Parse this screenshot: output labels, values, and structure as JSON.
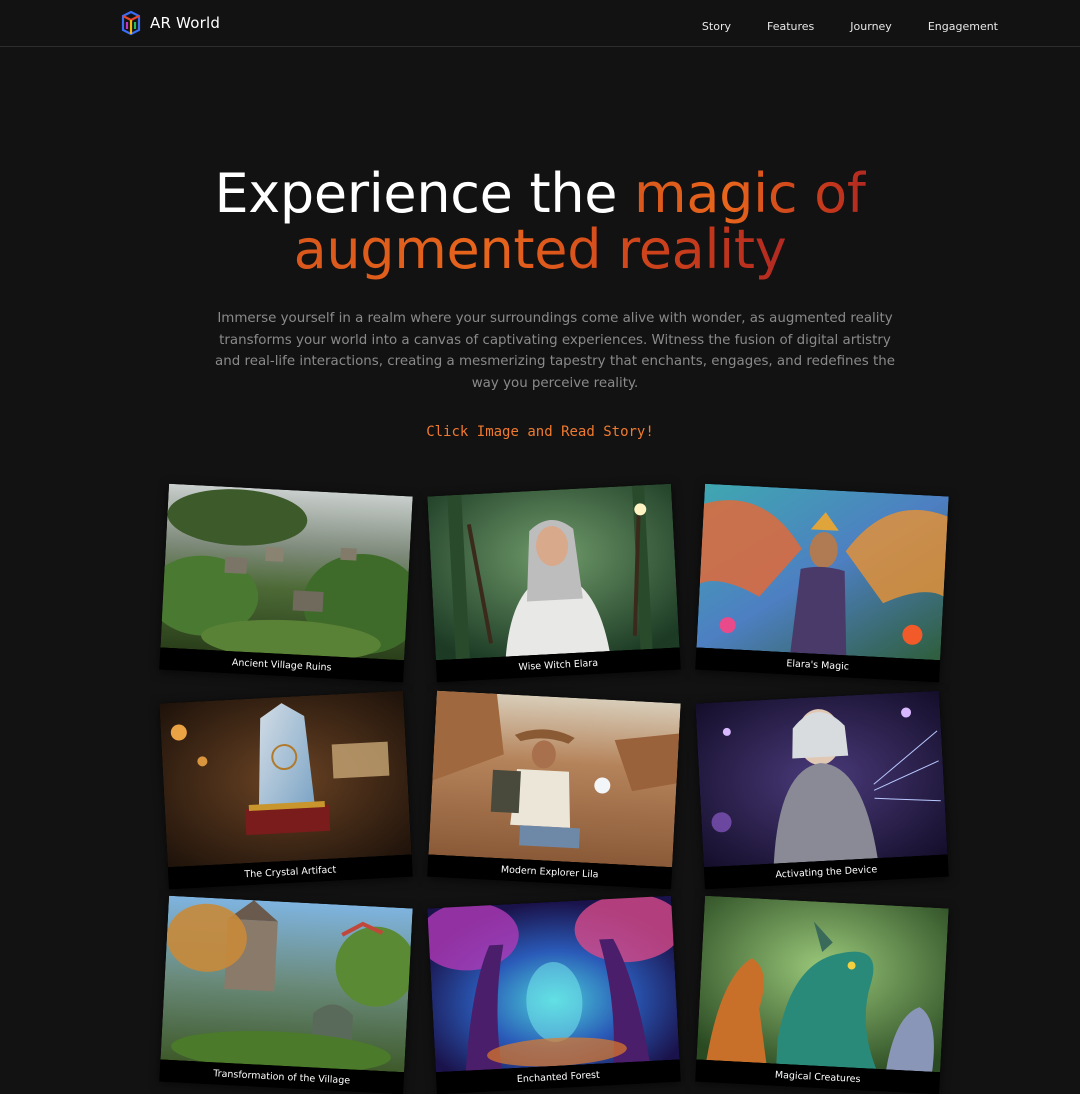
{
  "nav": {
    "brand": "AR World",
    "links": [
      "Story",
      "Features",
      "Journey",
      "Engagement"
    ]
  },
  "hero": {
    "title_plain": "Experience the ",
    "title_accent_line1": "magic of",
    "title_accent_line2": "augmented reality",
    "description": "Immerse yourself in a realm where your surroundings come alive with wonder, as augmented reality transforms your world into a canvas of captivating experiences. Witness the fusion of digital artistry and real-life interactions, creating a mesmerizing tapestry that enchants, engages, and redefines the way you perceive reality.",
    "cta": "Click Image and Read Story!"
  },
  "gallery": {
    "items": [
      {
        "caption": "Ancient Village Ruins"
      },
      {
        "caption": "Wise Witch Elara"
      },
      {
        "caption": "Elara's Magic"
      },
      {
        "caption": "The Crystal Artifact"
      },
      {
        "caption": "Modern Explorer Lila"
      },
      {
        "caption": "Activating the Device"
      },
      {
        "caption": "Transformation of the Village"
      },
      {
        "caption": "Enchanted Forest"
      },
      {
        "caption": "Magical Creatures"
      }
    ]
  },
  "colors": {
    "background": "#121212",
    "accent_orange": "#e8651c",
    "accent_red": "#b12a22",
    "cta": "#f07a30",
    "muted_text": "#8a8a8a"
  }
}
